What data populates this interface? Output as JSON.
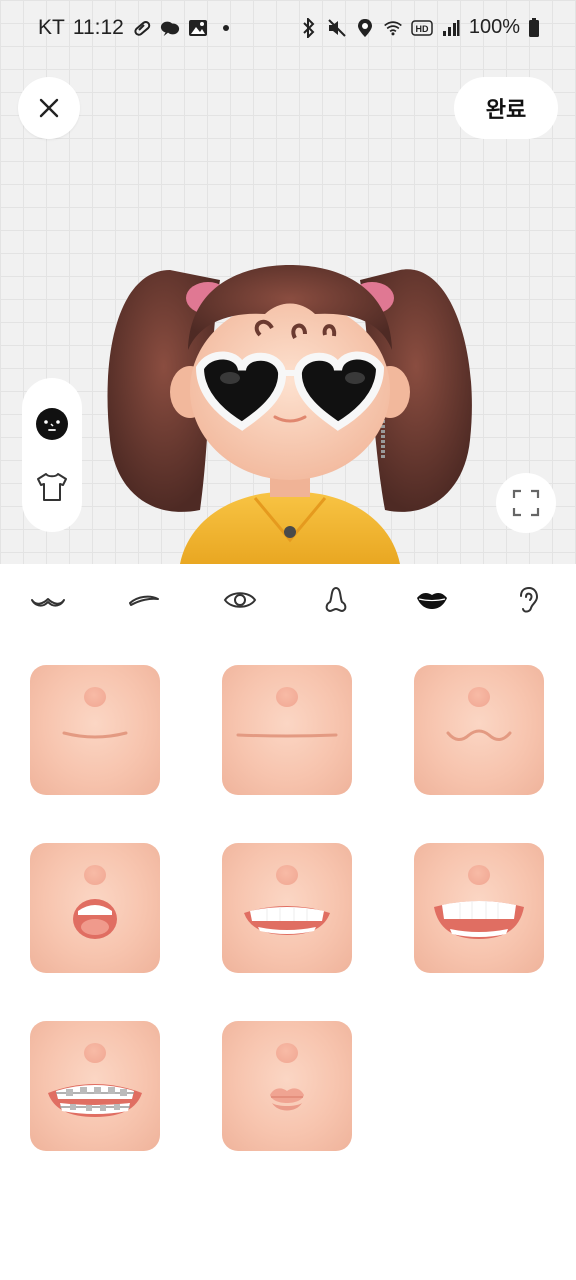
{
  "status_bar": {
    "carrier": "KT",
    "time": "11:12",
    "battery": "100%",
    "left_icons": [
      "pill-icon",
      "chat-bubble-icon",
      "image-icon",
      "dot-icon"
    ],
    "right_icons": [
      "bluetooth-icon",
      "mute-icon",
      "location-icon",
      "wifi-icon",
      "hd-icon",
      "signal-icon",
      "battery-icon"
    ]
  },
  "header": {
    "close_icon": "close-icon",
    "done_label": "완료"
  },
  "side_toggle": {
    "items": [
      {
        "icon": "face-icon",
        "active": true
      },
      {
        "icon": "shirt-icon",
        "active": false
      }
    ]
  },
  "expand_icon": "fullscreen-icon",
  "category_tabs": [
    {
      "icon": "mustache-icon",
      "active": false
    },
    {
      "icon": "eyebrow-icon",
      "active": false
    },
    {
      "icon": "eye-icon",
      "active": false
    },
    {
      "icon": "nose-icon",
      "active": false
    },
    {
      "icon": "lips-icon",
      "active": true
    },
    {
      "icon": "ear-icon",
      "active": false
    }
  ],
  "mouth_options": [
    {
      "style": "smile-line",
      "selected": true
    },
    {
      "style": "straight-line",
      "selected": false
    },
    {
      "style": "wavy-line",
      "selected": false
    },
    {
      "style": "open-surprised",
      "selected": false
    },
    {
      "style": "grin-teeth",
      "selected": false
    },
    {
      "style": "wide-grin-teeth",
      "selected": false
    },
    {
      "style": "braces-teeth",
      "selected": false
    },
    {
      "style": "pouty-lips",
      "selected": false
    }
  ],
  "colors": {
    "skin": "#f7c4ae",
    "hair": "#6b3a30",
    "shirt": "#f3b735",
    "selection": "#111111"
  }
}
